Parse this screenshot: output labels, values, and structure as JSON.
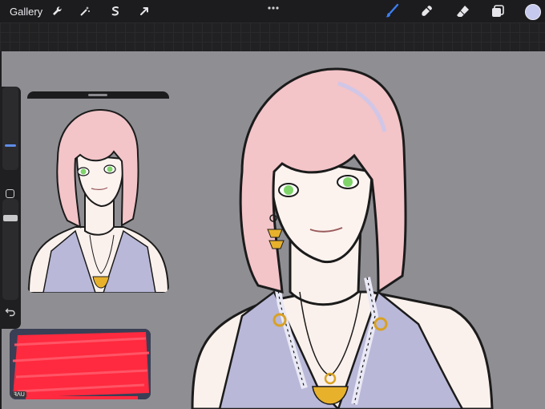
{
  "toolbar": {
    "gallery_label": "Gallery",
    "left_tools": [
      {
        "name": "wrench-icon"
      },
      {
        "name": "magic-wand-icon"
      },
      {
        "name": "selection-s-icon"
      },
      {
        "name": "arrow-cursor-icon"
      }
    ],
    "more_icon": "more-dots-icon",
    "right_tools": [
      {
        "name": "brush-icon",
        "active": true
      },
      {
        "name": "smudge-icon",
        "active": false
      },
      {
        "name": "eraser-icon",
        "active": false
      },
      {
        "name": "layers-icon",
        "active": false
      }
    ],
    "current_color": "#c6c9ee"
  },
  "colors": {
    "toolbar_bg": "#1c1c1e",
    "canvas_bg": "#8f8e93",
    "accent": "#3b7ff1",
    "scribble": "#ff2a3f"
  },
  "sidebar": {
    "brush_size_icon": "brush-size-slider",
    "modify_icon": "square-icon",
    "opacity_icon": "opacity-slider",
    "undo_icon": "undo-icon"
  },
  "reference": {
    "title": "reference-window"
  },
  "layer_preview": {
    "label": "ꟻΛU"
  }
}
